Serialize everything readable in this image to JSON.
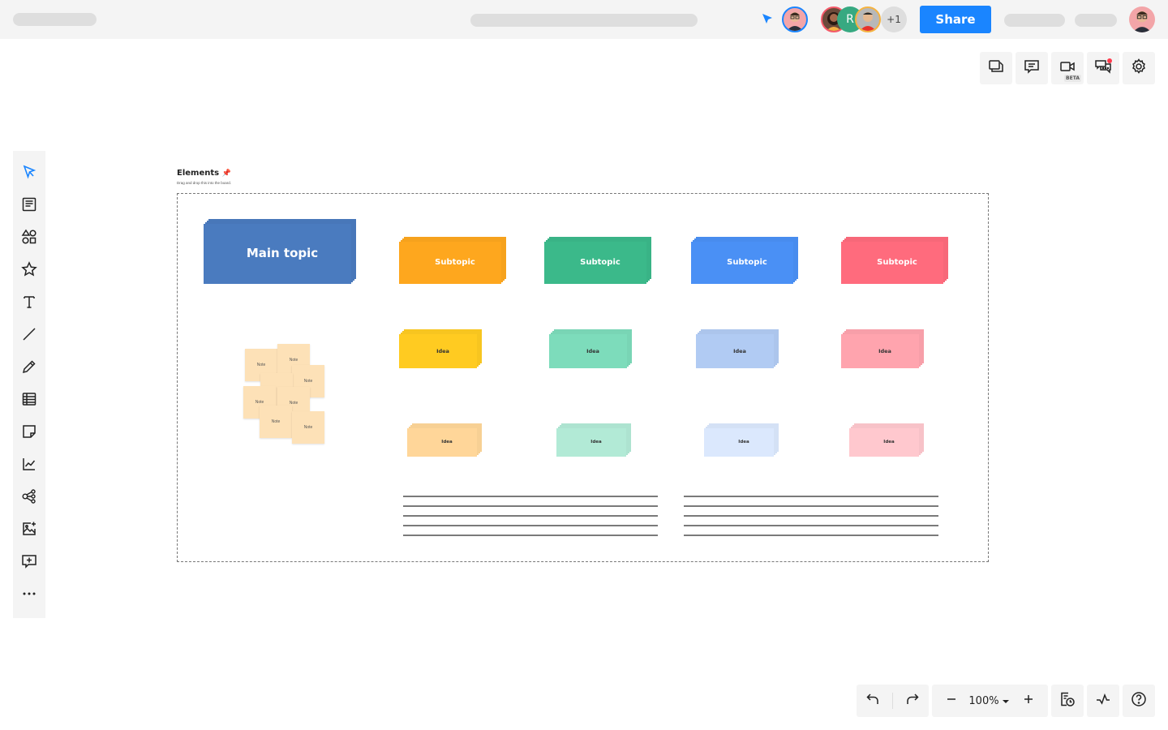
{
  "topbar": {
    "share_label": "Share",
    "collaborator_initial": "R",
    "more_collaborators": "+1"
  },
  "toolbar_right": {
    "items": [
      {
        "name": "pages",
        "icon": "pages-icon"
      },
      {
        "name": "comments",
        "icon": "comment-icon"
      },
      {
        "name": "video",
        "icon": "video-camera-icon",
        "badge": "BETA"
      },
      {
        "name": "chat",
        "icon": "chat-icon",
        "notification": true
      },
      {
        "name": "settings",
        "icon": "gear-icon"
      }
    ]
  },
  "sidebar": {
    "items": [
      {
        "name": "select",
        "icon": "cursor-icon",
        "active": true
      },
      {
        "name": "templates",
        "icon": "template-icon"
      },
      {
        "name": "shapes",
        "icon": "shapes-icon"
      },
      {
        "name": "icons",
        "icon": "star-icon"
      },
      {
        "name": "text",
        "icon": "text-icon"
      },
      {
        "name": "line",
        "icon": "line-icon"
      },
      {
        "name": "pen",
        "icon": "pencil-icon"
      },
      {
        "name": "table",
        "icon": "table-icon"
      },
      {
        "name": "sticky-note",
        "icon": "sticky-note-icon"
      },
      {
        "name": "chart",
        "icon": "chart-icon"
      },
      {
        "name": "mindmap",
        "icon": "mindmap-icon"
      },
      {
        "name": "image",
        "icon": "image-add-icon"
      },
      {
        "name": "comment",
        "icon": "comment-add-icon"
      },
      {
        "name": "more",
        "icon": "more-icon"
      }
    ]
  },
  "board": {
    "section_title": "Elements",
    "section_icon": "pin-icon",
    "section_subtitle": "Drag and drop this into the board.",
    "main_topic": {
      "label": "Main topic",
      "color": "#4a7bbf"
    },
    "subtopics": [
      {
        "label": "Subtopic",
        "color": "#fea71e"
      },
      {
        "label": "Subtopic",
        "color": "#3bb98a"
      },
      {
        "label": "Subtopic",
        "color": "#4a90f5"
      },
      {
        "label": "Subtopic",
        "color": "#ff6b7d"
      }
    ],
    "ideas_row1": [
      {
        "label": "Idea",
        "color": "#ffcb21"
      },
      {
        "label": "Idea",
        "color": "#7ddcbb"
      },
      {
        "label": "Idea",
        "color": "#b1cbf3"
      },
      {
        "label": "Idea",
        "color": "#ffa4ae"
      }
    ],
    "ideas_row2": [
      {
        "label": "Idea",
        "color": "#ffd699"
      },
      {
        "label": "Idea",
        "color": "#b2ead6"
      },
      {
        "label": "Idea",
        "color": "#dbe8fd"
      },
      {
        "label": "Idea",
        "color": "#ffc8ce"
      }
    ],
    "notes": [
      "Note",
      "Note",
      "Note",
      "Note",
      "Note",
      "Note",
      "Note",
      "Note"
    ]
  },
  "bottom_toolbar": {
    "zoom_level": "100%"
  }
}
